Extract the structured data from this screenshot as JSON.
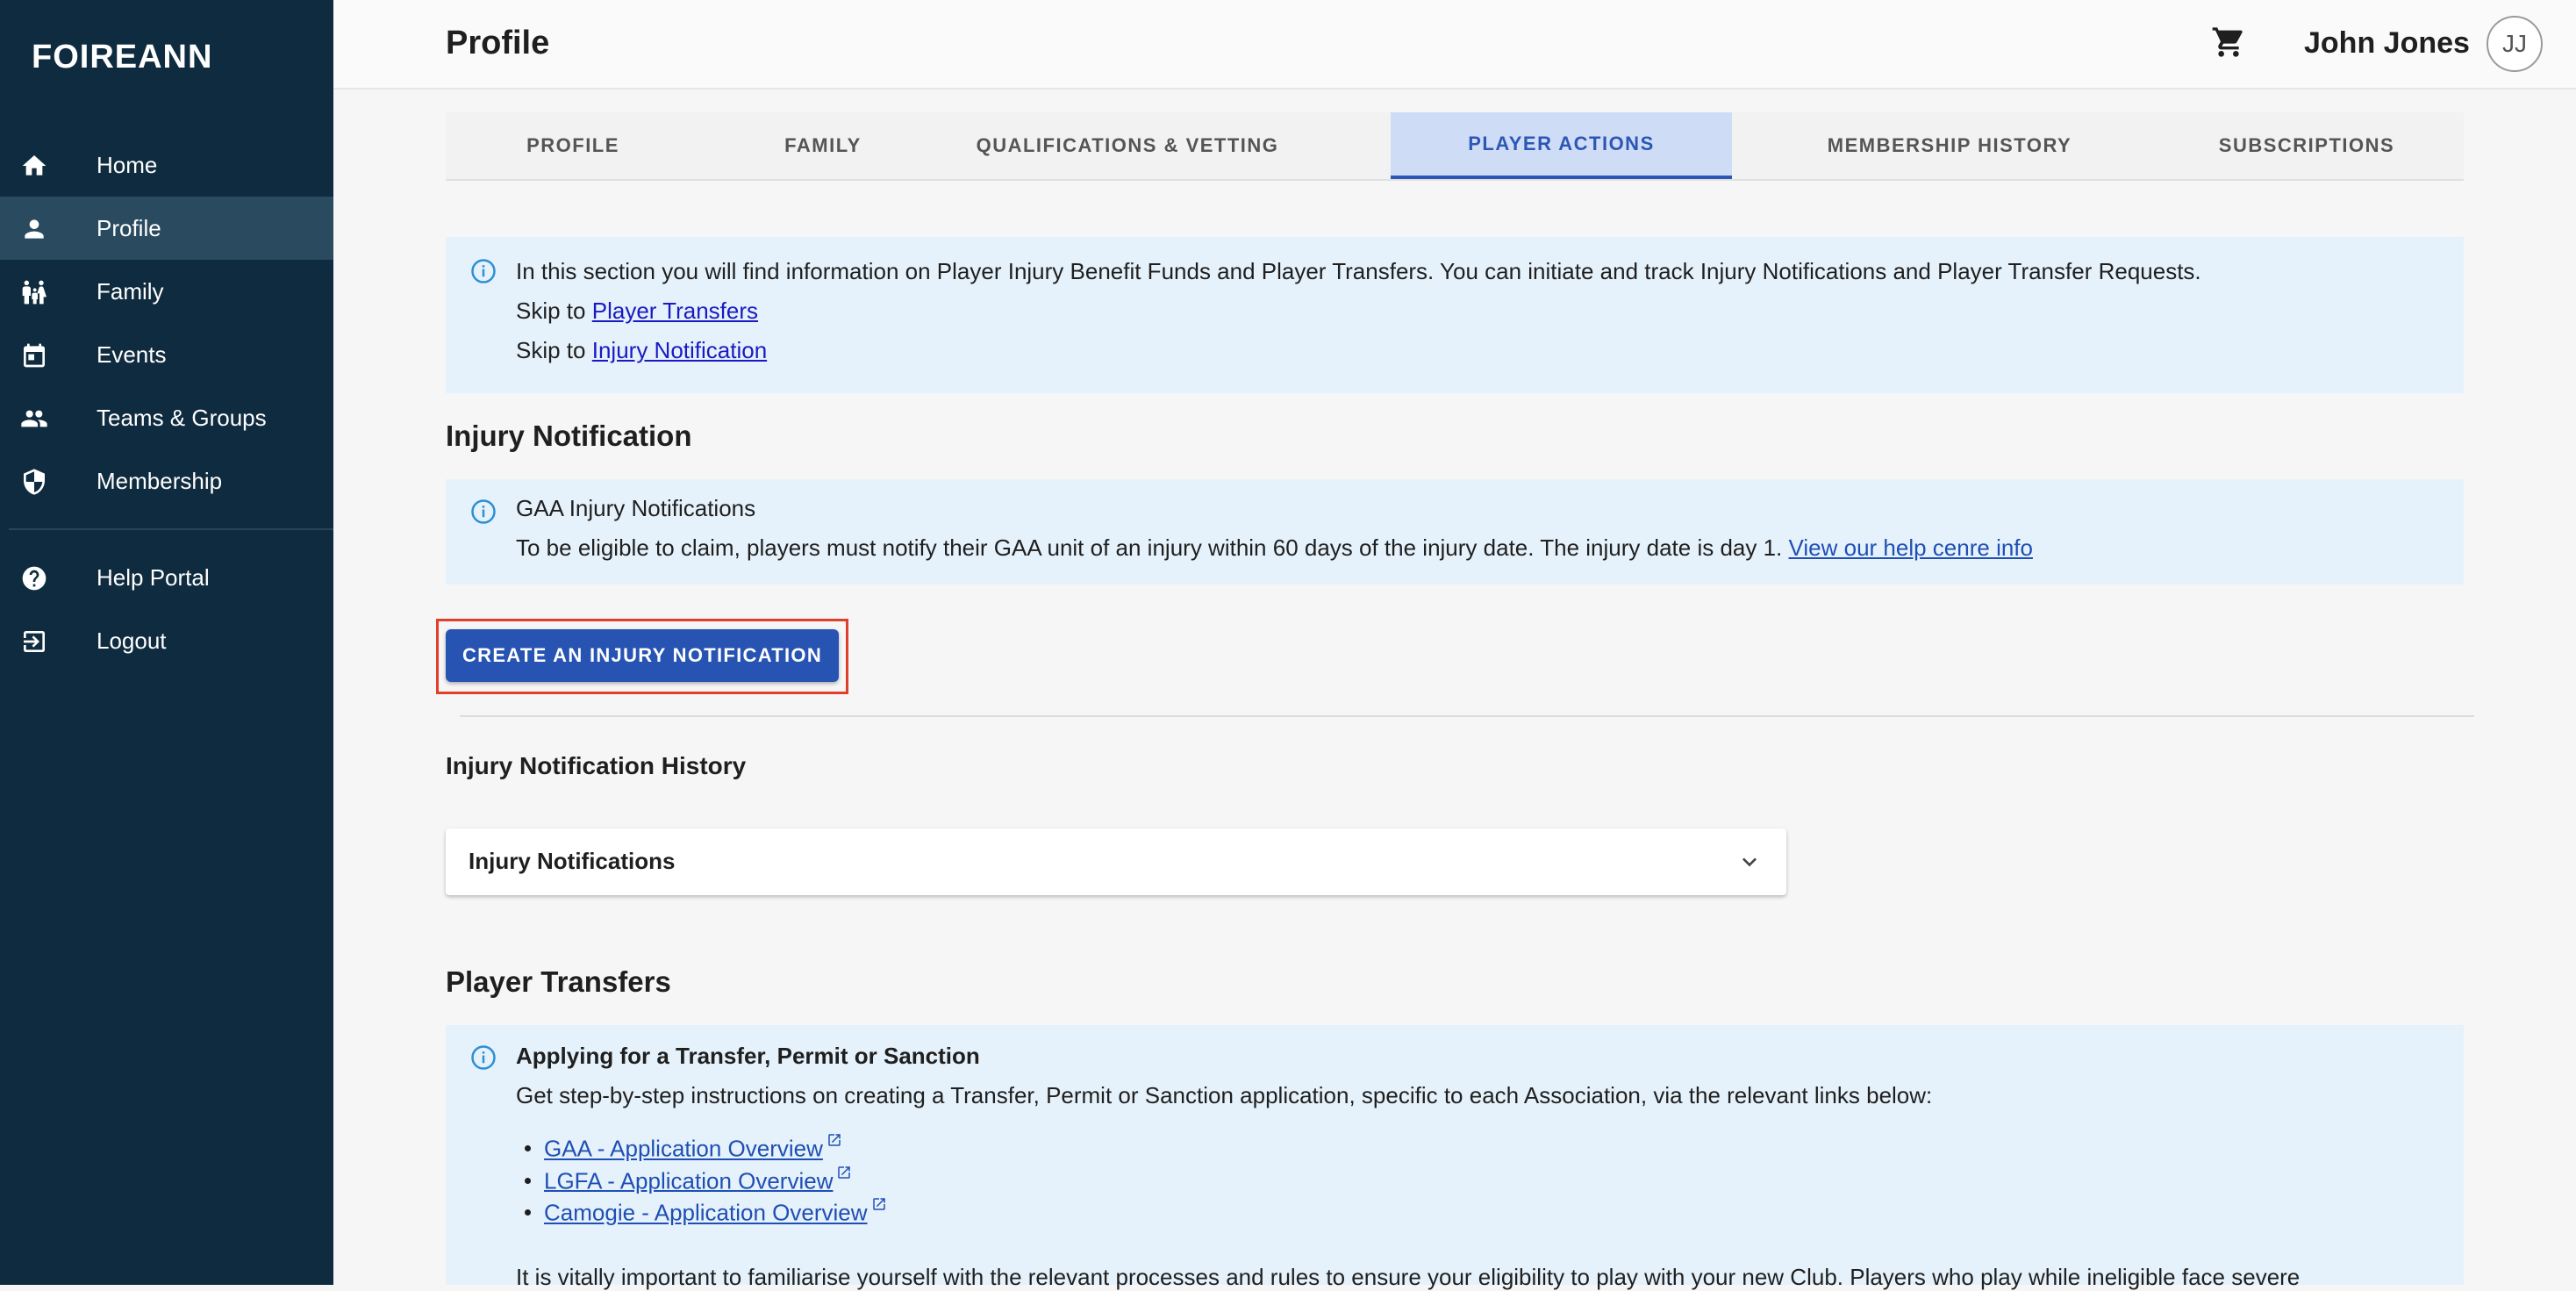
{
  "app": {
    "logo": "FOIREANN"
  },
  "sidebar": {
    "items": [
      {
        "label": "Home",
        "icon": "home-icon"
      },
      {
        "label": "Profile",
        "icon": "person-icon",
        "active": true
      },
      {
        "label": "Family",
        "icon": "family-icon"
      },
      {
        "label": "Events",
        "icon": "calendar-icon"
      },
      {
        "label": "Teams & Groups",
        "icon": "people-icon"
      },
      {
        "label": "Membership",
        "icon": "shield-icon"
      }
    ],
    "footer_items": [
      {
        "label": "Help Portal",
        "icon": "help-icon"
      },
      {
        "label": "Logout",
        "icon": "logout-icon"
      }
    ]
  },
  "header": {
    "title": "Profile",
    "user_name": "John Jones",
    "avatar_initials": "JJ",
    "cart_icon": "cart-icon"
  },
  "tabs": [
    {
      "label": "PROFILE"
    },
    {
      "label": "FAMILY"
    },
    {
      "label": "QUALIFICATIONS & VETTING"
    },
    {
      "label": "PLAYER ACTIONS",
      "active": true
    },
    {
      "label": "MEMBERSHIP HISTORY"
    },
    {
      "label": "SUBSCRIPTIONS"
    }
  ],
  "intro": {
    "text": "In this section you will find information on Player Injury Benefit Funds and Player Transfers. You can initiate and track Injury Notifications and Player Transfer Requests.",
    "skip_prefix": "Skip to",
    "skip_transfers": "Player Transfers",
    "skip_injury": "Injury Notification"
  },
  "injury": {
    "heading": "Injury Notification",
    "info_title": "GAA Injury Notifications",
    "info_text": "To be eligible to claim, players must notify their GAA unit of an injury within 60 days of the injury date. The injury date is day 1.",
    "info_link": "View our help cenre info",
    "create_button": "CREATE AN INJURY NOTIFICATION",
    "history_heading": "Injury Notification History",
    "accordion_title": "Injury Notifications"
  },
  "transfers": {
    "heading": "Player Transfers",
    "info_title": "Applying for a Transfer, Permit or Sanction",
    "info_text": "Get step-by-step instructions on creating a Transfer, Permit or Sanction application, specific to each Association, via the relevant links below:",
    "links": [
      "GAA - Application Overview",
      "LGFA - Application Overview",
      "Camogie - Application Overview"
    ],
    "footer_text": "It is vitally important to familiarise yourself with the relevant processes and rules to ensure your eligibility to play with your new Club. Players who play while ineligible face severe"
  },
  "colors": {
    "sidebar_bg": "#0f2b3f",
    "accent": "#2753b3",
    "info_bg": "#e6f2fb",
    "highlight": "#e0402a"
  }
}
